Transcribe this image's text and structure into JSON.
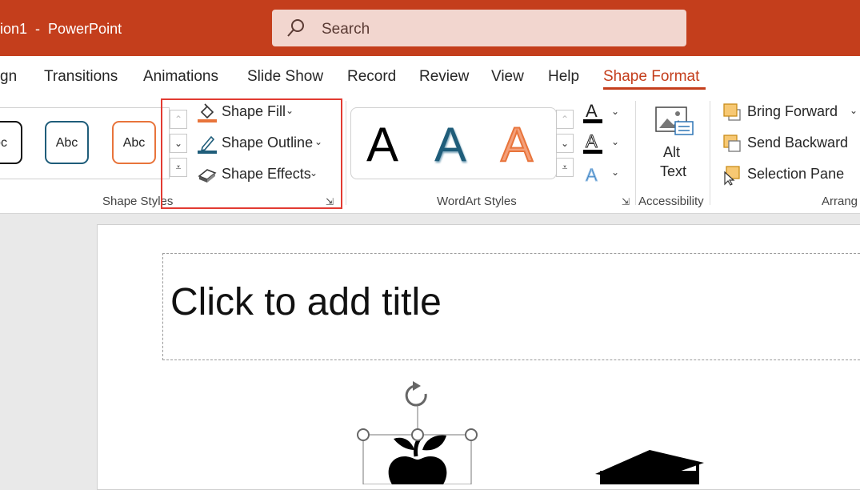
{
  "window": {
    "title": "ion1  -  PowerPoint",
    "search_placeholder": "Search"
  },
  "tabs": [
    "gn",
    "Transitions",
    "Animations",
    "Slide Show",
    "Record",
    "Review",
    "View",
    "Help",
    "Shape Format"
  ],
  "active_tab": "Shape Format",
  "ribbon": {
    "shape_styles": {
      "label": "Shape Styles",
      "thumbnails": [
        "bc",
        "Abc",
        "Abc"
      ],
      "fill": "Shape Fill",
      "outline": "Shape Outline",
      "effects": "Shape Effects"
    },
    "wordart": {
      "label": "WordArt Styles",
      "samples": [
        "A",
        "A",
        "A"
      ]
    },
    "accessibility": {
      "label": "Accessibility",
      "alt_text_line1": "Alt",
      "alt_text_line2": "Text"
    },
    "arrange": {
      "label": "Arrang",
      "bring_forward": "Bring Forward",
      "send_backward": "Send Backward",
      "selection_pane": "Selection Pane"
    }
  },
  "slide": {
    "title_placeholder": "Click to add title"
  },
  "colors": {
    "accent": "#c43e1c",
    "highlight_box": "#e23b32",
    "teal": "#1f5d7a",
    "orange": "#e8743b"
  },
  "icons": [
    "search-icon",
    "paint-bucket-icon",
    "pen-outline-icon",
    "shape-effects-icon",
    "font-color-icon",
    "text-outline-icon",
    "text-effects-icon",
    "alt-text-icon",
    "bring-forward-icon",
    "send-backward-icon",
    "selection-pane-icon",
    "rotate-handle-icon",
    "apple-icon",
    "graduation-cap-icon"
  ]
}
